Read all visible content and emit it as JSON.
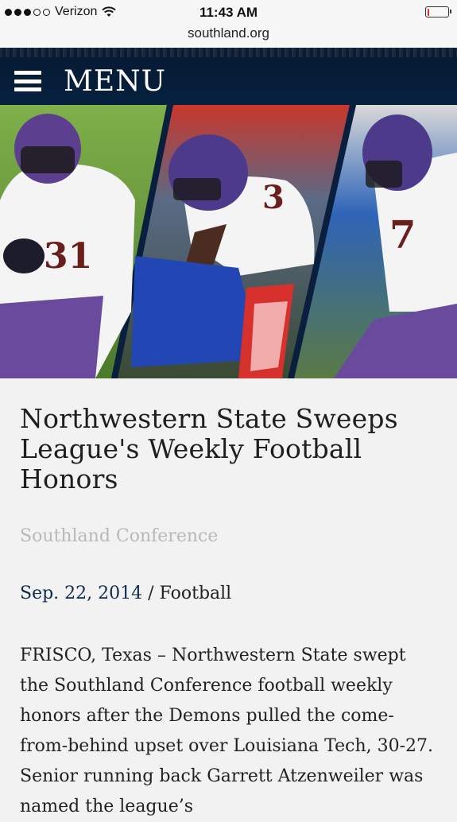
{
  "status_bar": {
    "carrier": "Verizon",
    "time": "11:43 AM",
    "signal_bars_filled": 3,
    "signal_bars_total": 5,
    "battery_level": 0.12,
    "icons": [
      "wifi-icon",
      "battery-icon"
    ]
  },
  "browser": {
    "url": "southland.org"
  },
  "nav": {
    "menu_label": "MENU",
    "menu_icon": "hamburger-icon",
    "background": "#05213f"
  },
  "hero": {
    "jersey_numbers": [
      "31",
      "3",
      "7"
    ]
  },
  "article": {
    "headline": "Northwestern State Sweeps League's Weekly Football Honors",
    "source": "Southland Conference",
    "date": "Sep. 22, 2014",
    "separator": " / ",
    "category": "Football",
    "body": "FRISCO, Texas – Northwestern State swept the Southland Conference football weekly honors after the Demons pulled the come-from-behind upset over Louisiana Tech, 30-27. Senior running back Garrett Atzenweiler was named the league’s"
  },
  "colors": {
    "accent_navy": "#0f2a4f",
    "source_gray": "#b9b9b9",
    "page_bg": "#f2f2f2"
  }
}
